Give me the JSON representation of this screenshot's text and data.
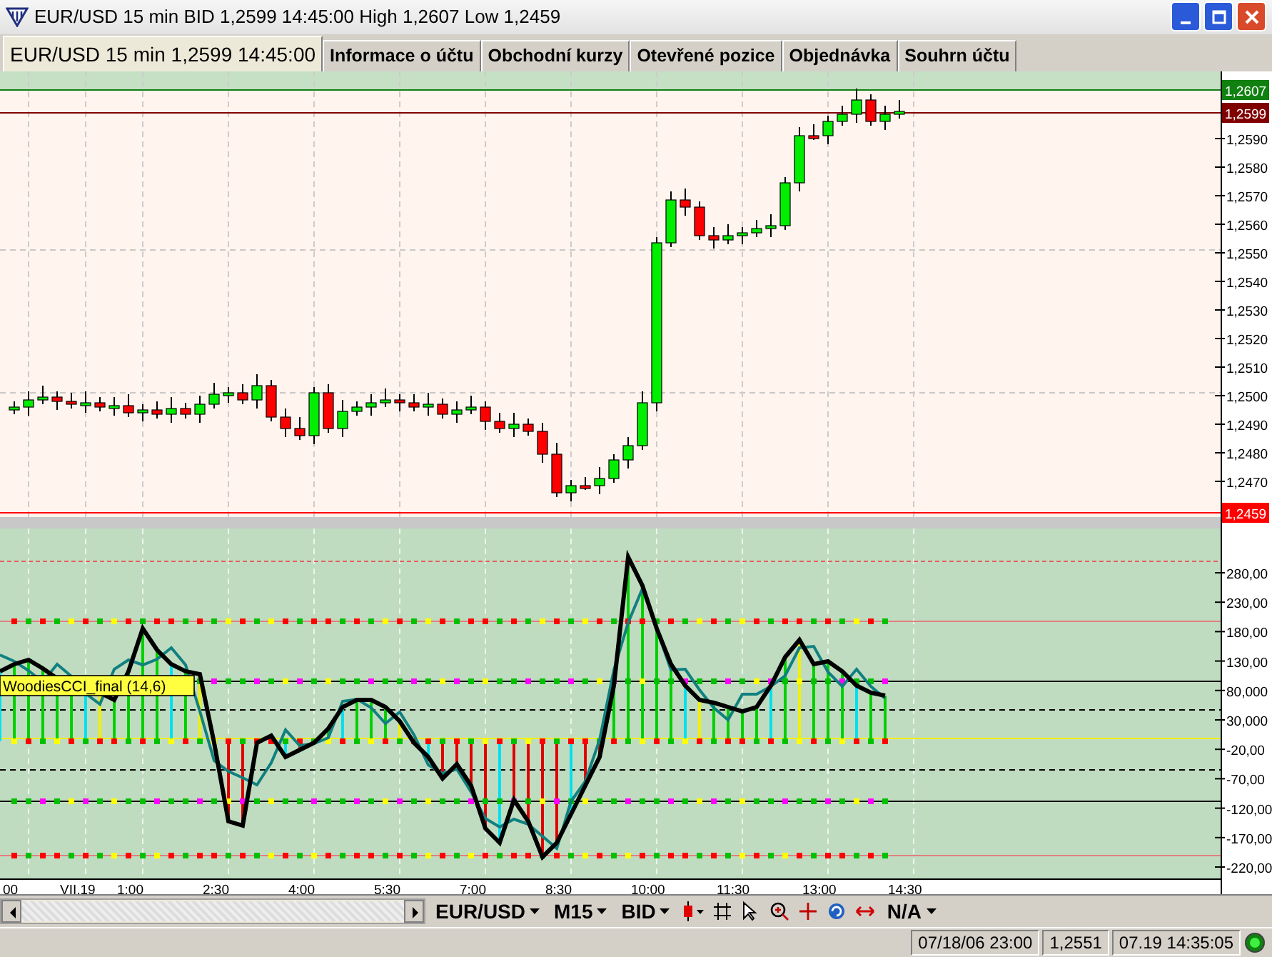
{
  "window": {
    "title": "EUR/USD 15 min BID 1,2599 14:45:00 High 1,2607 Low 1,2459"
  },
  "tabs": [
    {
      "label": "EUR/USD 15 min 1,2599 14:45:00",
      "selected": true
    },
    {
      "label": "Informace o účtu",
      "selected": false
    },
    {
      "label": "Obchodní kurzy",
      "selected": false
    },
    {
      "label": "Otevřené pozice",
      "selected": false
    },
    {
      "label": "Objednávka",
      "selected": false
    },
    {
      "label": "Souhrn účtu",
      "selected": false
    }
  ],
  "price_axis": {
    "ticks": [
      "1,2590",
      "1,2580",
      "1,2570",
      "1,2560",
      "1,2550",
      "1,2540",
      "1,2530",
      "1,2520",
      "1,2510",
      "1,2500",
      "1,2490",
      "1,2480",
      "1,2470"
    ],
    "markers": [
      {
        "label": "1,2607",
        "kind": "high"
      },
      {
        "label": "1,2599",
        "kind": "bid"
      },
      {
        "label": "1,2459",
        "kind": "low"
      }
    ]
  },
  "indicator": {
    "label": "WoodiesCCI_final (14,6)",
    "ticks": [
      "280,00",
      "230,00",
      "180,00",
      "130,00",
      "80,000",
      "30,000",
      "-20,00",
      "-70,00",
      "-120,00",
      "-170,00",
      "-220,00"
    ]
  },
  "time_axis": [
    "00",
    "VII.19",
    "1:00",
    "2:30",
    "4:00",
    "5:30",
    "7:00",
    "8:30",
    "10:00",
    "11:30",
    "13:00",
    "14:30"
  ],
  "toolbar": {
    "selectors": [
      "EUR/USD",
      "M15",
      "BID"
    ],
    "account": "N/A"
  },
  "status_bar": [
    "07/18/06 23:00",
    "1,2551",
    "07.19 14:35:05"
  ]
}
